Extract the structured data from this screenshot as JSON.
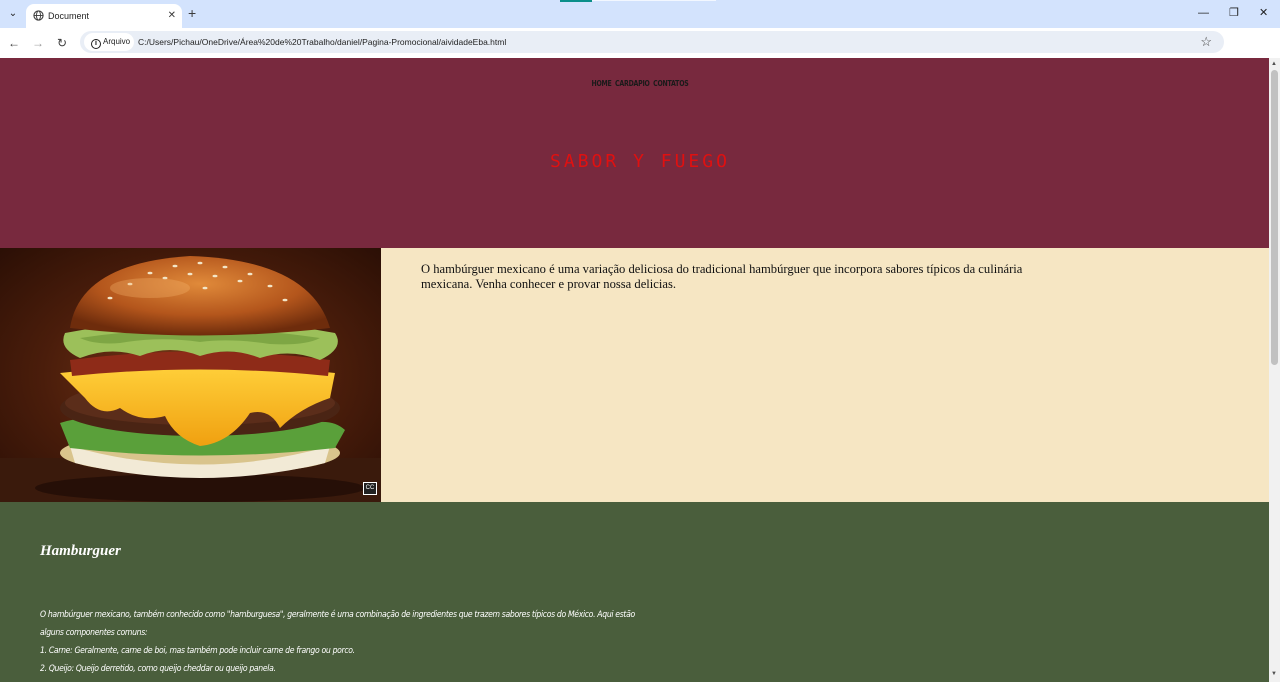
{
  "browser": {
    "tab_title": "Document",
    "tab_close": "✕",
    "new_tab": "+",
    "tab_search": "⌄",
    "window_controls": {
      "minimize": "—",
      "restore": "❐",
      "close": "✕"
    },
    "nav": {
      "back": "←",
      "forward": "→",
      "reload": "↻"
    },
    "site_info_label": "Arquivo",
    "url": "C:/Users/Pichau/OneDrive/Área%20de%20Trabalho/daniel/Pagina-Promocional/aividadeEba.html",
    "bookmark": "☆",
    "menu": "⋮"
  },
  "page": {
    "nav_links": [
      "HOME",
      "CARDAPIO",
      "CONTATOS"
    ],
    "brand": "SABOR Y FUEGO",
    "hero_text": "O hambúrguer mexicano é uma variação deliciosa do tradicional hambúrguer que incorpora sabores típicos da culinária mexicana. Venha conhecer e provar nossa delicias.",
    "image_badge": "CC",
    "section_title": "Hamburguer",
    "section_lines": [
      "O hambúrguer mexicano, também conhecido como \"hamburguesa\", geralmente é uma combinação de ingredientes que trazem sabores típicos do México. Aqui estão",
      "alguns componentes comuns:",
      "1. Carne: Geralmente, carne de boi, mas também pode incluir carne de frango ou porco.",
      "2. Queijo: Queijo derretido, como queijo cheddar ou queijo panela."
    ]
  },
  "colors": {
    "header_bg": "#78293e",
    "brand": "#e01010",
    "hero_bg": "#f6e6c3",
    "section_bg": "#4a5e3c",
    "tabbar_bg": "#d3e3fd"
  }
}
